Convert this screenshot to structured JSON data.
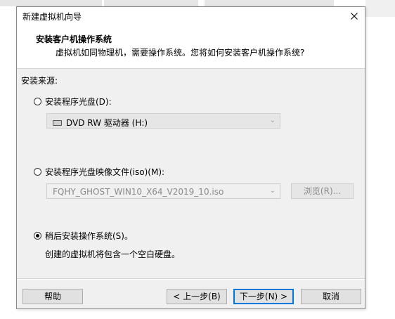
{
  "window": {
    "title": "新建虚拟机向导",
    "close_glyph": "✕"
  },
  "header": {
    "title": "安装客户机操作系统",
    "subtitle": "虚拟机如同物理机，需要操作系统。您将如何安装客户机操作系统?"
  },
  "source": {
    "label": "安装来源:",
    "options": [
      {
        "label": "安装程序光盘(D):",
        "selected": false
      },
      {
        "label": "安装程序光盘映像文件(iso)(M):",
        "selected": false
      },
      {
        "label": "稍后安装操作系统(S)。",
        "selected": true
      }
    ],
    "disc_drive": {
      "value": "DVD RW 驱动器 (H:)",
      "icon": "dvd-drive-icon"
    },
    "iso_path": {
      "value": "FQHY_GHOST_WIN10_X64_V2019_10.iso"
    },
    "browse_label": "浏览(R)...",
    "later_note": "创建的虚拟机将包含一个空白硬盘。"
  },
  "buttons": {
    "help": "帮助",
    "back": "< 上一步(B)",
    "next": "下一步(N) >",
    "cancel": "取消"
  },
  "colors": {
    "dialog_bg": "#f0f0f0",
    "header_bg": "#ffffff",
    "focus_border": "#0078d7"
  }
}
